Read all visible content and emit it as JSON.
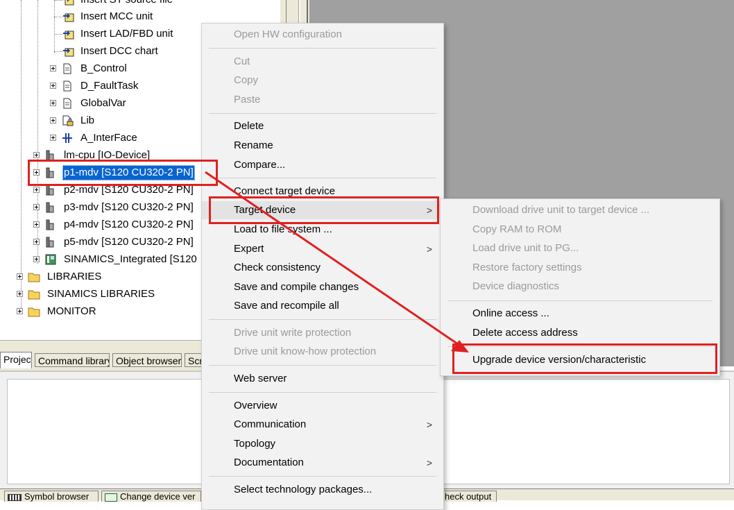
{
  "tree": {
    "rows": [
      {
        "label": "Insert ST source file"
      },
      {
        "label": "Insert MCC unit"
      },
      {
        "label": "Insert LAD/FBD unit"
      },
      {
        "label": "Insert DCC chart"
      },
      {
        "label": "B_Control"
      },
      {
        "label": "D_FaultTask"
      },
      {
        "label": "GlobalVar"
      },
      {
        "label": "Lib"
      },
      {
        "label": "A_InterFace"
      },
      {
        "label": "lm-cpu [IO-Device]"
      },
      {
        "label": "p1-mdv [S120 CU320-2 PN]"
      },
      {
        "label": "p2-mdv [S120 CU320-2 PN]"
      },
      {
        "label": "p3-mdv [S120 CU320-2 PN]"
      },
      {
        "label": "p4-mdv [S120 CU320-2 PN]"
      },
      {
        "label": "p5-mdv [S120 CU320-2 PN]"
      },
      {
        "label": "SINAMICS_Integrated [S120"
      },
      {
        "label": "LIBRARIES"
      },
      {
        "label": "SINAMICS LIBRARIES"
      },
      {
        "label": "MONITOR"
      }
    ]
  },
  "tabs": [
    "Project",
    "Command library",
    "Object browser",
    "Scr"
  ],
  "bottom_tabs": [
    "Symbol browser",
    "Change device ver",
    "heck output"
  ],
  "context_menu": {
    "items": [
      {
        "label": "Open HW configuration",
        "disabled": true
      },
      {
        "label": "Cut",
        "disabled": true
      },
      {
        "label": "Copy",
        "disabled": true
      },
      {
        "label": "Paste",
        "disabled": true
      },
      {
        "label": "Delete"
      },
      {
        "label": "Rename"
      },
      {
        "label": "Compare..."
      },
      {
        "label": "Connect target device"
      },
      {
        "label": "Target device",
        "submenu": true
      },
      {
        "label": "Load to file system ..."
      },
      {
        "label": "Expert",
        "submenu": true
      },
      {
        "label": "Check consistency"
      },
      {
        "label": "Save and compile changes"
      },
      {
        "label": "Save and recompile all"
      },
      {
        "label": "Drive unit write protection",
        "disabled": true
      },
      {
        "label": "Drive unit know-how protection",
        "disabled": true
      },
      {
        "label": "Web server"
      },
      {
        "label": "Overview"
      },
      {
        "label": "Communication",
        "submenu": true
      },
      {
        "label": "Topology"
      },
      {
        "label": "Documentation",
        "submenu": true
      },
      {
        "label": "Select technology packages..."
      }
    ],
    "submenu_arrow": ">"
  },
  "sub_menu": {
    "items": [
      {
        "label": "Download drive unit to target device ...",
        "disabled": true
      },
      {
        "label": "Copy RAM to ROM",
        "disabled": true
      },
      {
        "label": "Load drive unit to PG...",
        "disabled": true
      },
      {
        "label": "Restore factory settings",
        "disabled": true
      },
      {
        "label": "Device diagnostics",
        "disabled": true
      },
      {
        "label": "Online access ..."
      },
      {
        "label": "Delete access address"
      },
      {
        "label": "Upgrade device version/characteristic"
      }
    ]
  },
  "colors": {
    "selection": "#0a64d0",
    "annotation_red": "#e02020",
    "workspace_gray": "#a0a0a0"
  }
}
